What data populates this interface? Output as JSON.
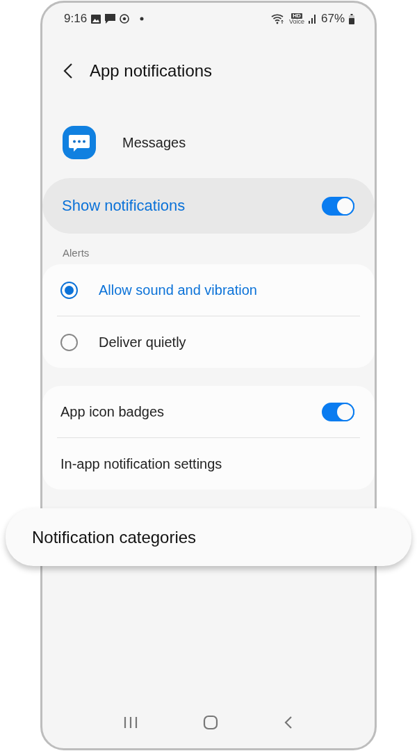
{
  "status_bar": {
    "time": "9:16",
    "hd_label": "HD",
    "voice_label": "Voice",
    "battery": "67%"
  },
  "header": {
    "title": "App notifications"
  },
  "app": {
    "name": "Messages"
  },
  "master_switch": {
    "label": "Show notifications",
    "on": true
  },
  "sections": [
    {
      "title": "Alerts",
      "items": [
        {
          "kind": "radio",
          "label": "Allow sound and vibration",
          "selected": true
        },
        {
          "kind": "radio",
          "label": "Deliver quietly",
          "selected": false
        }
      ]
    },
    {
      "items": [
        {
          "kind": "toggle",
          "label": "App icon badges",
          "on": true
        },
        {
          "kind": "link",
          "label": "In-app notification settings"
        }
      ]
    }
  ],
  "highlight": {
    "label": "Notification categories"
  }
}
